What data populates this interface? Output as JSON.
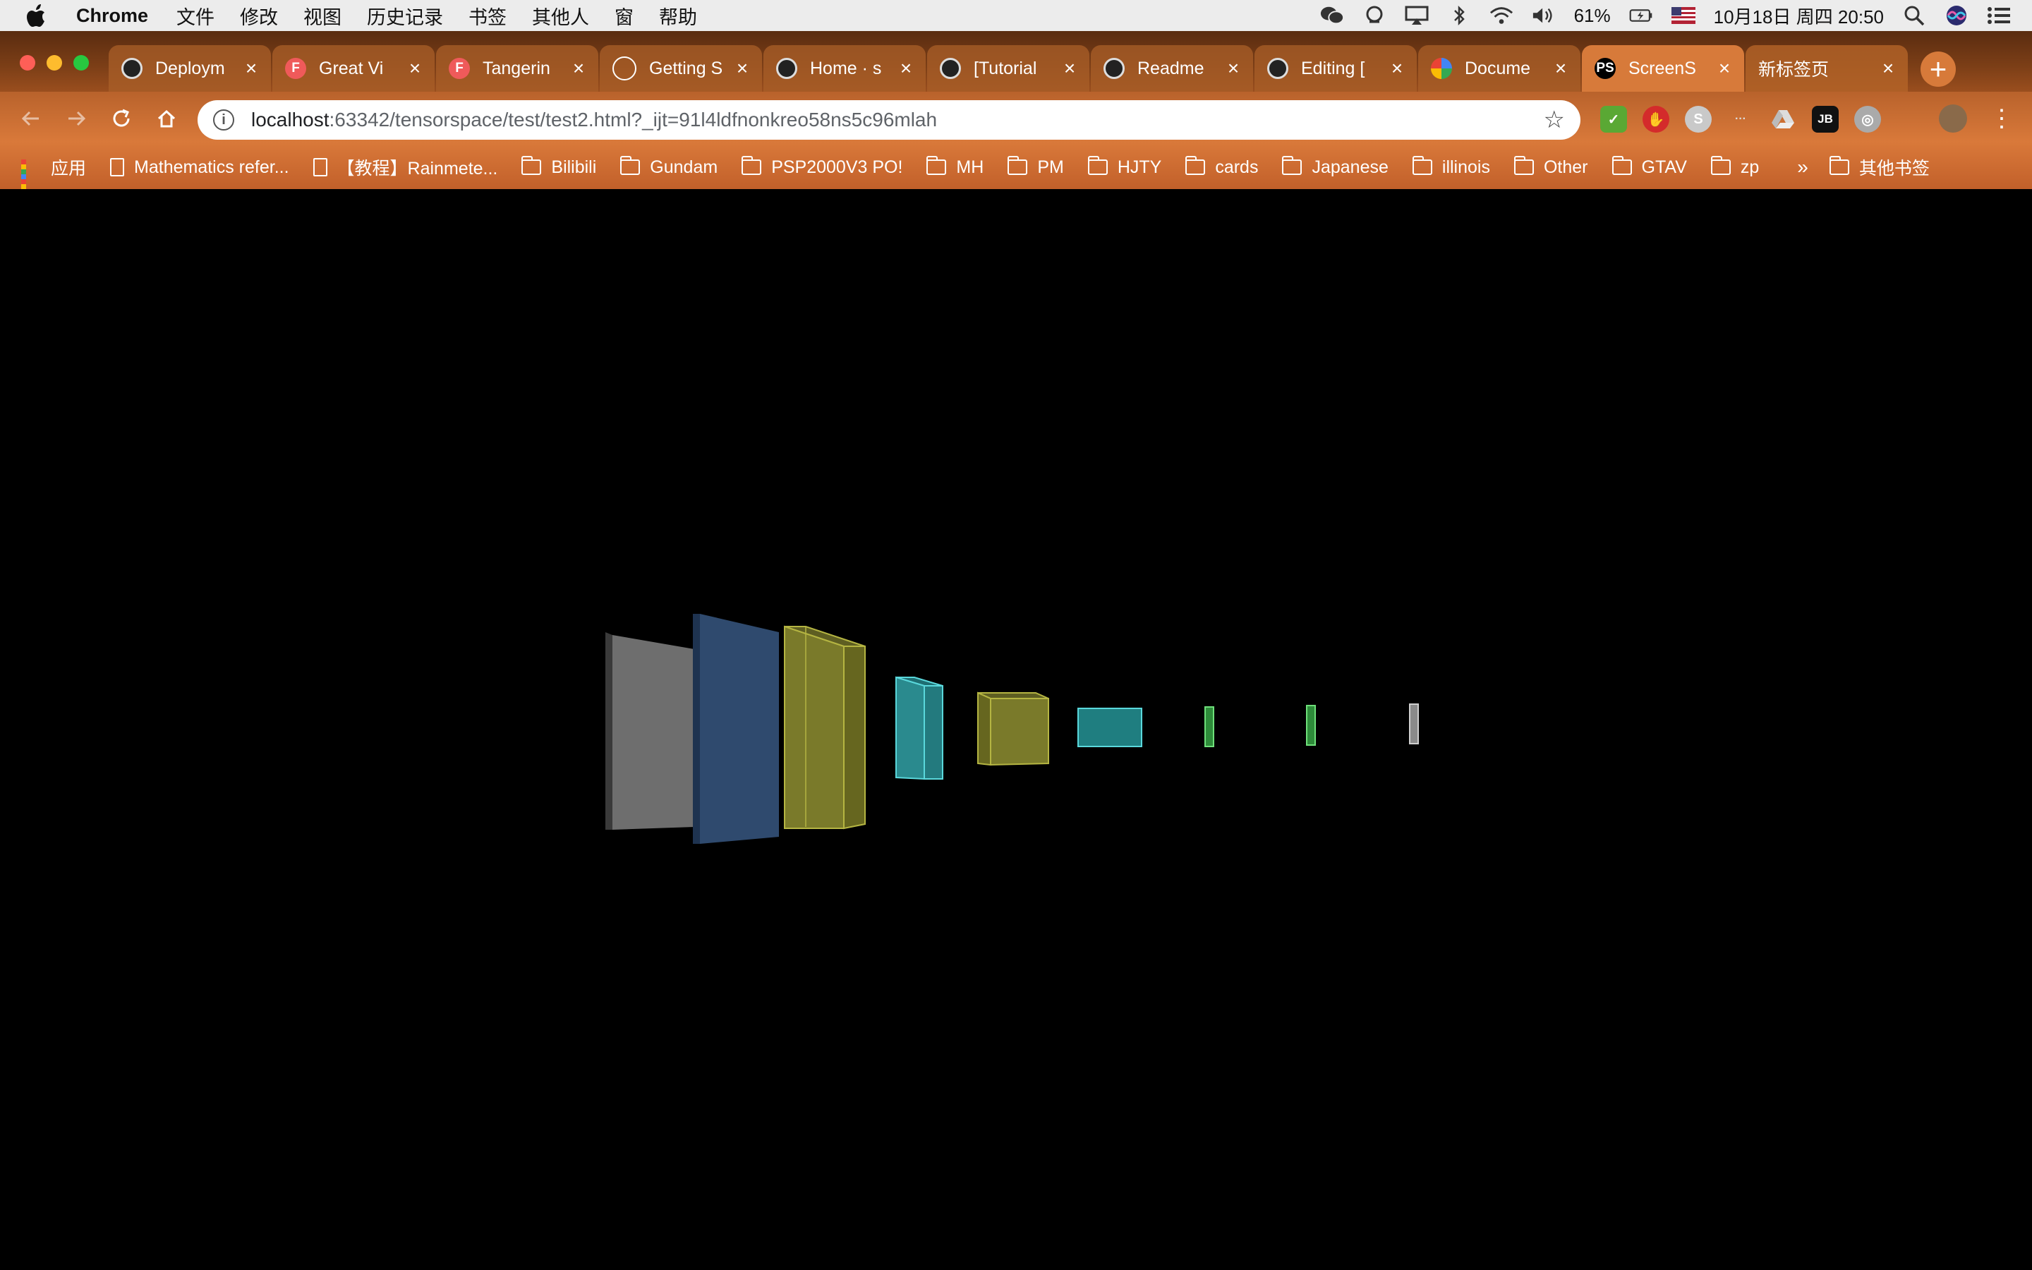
{
  "menubar": {
    "app_name": "Chrome",
    "items": [
      "文件",
      "修改",
      "视图",
      "历史记录",
      "书签",
      "其他人",
      "窗",
      "帮助"
    ],
    "battery": "61%",
    "datetime": "10月18日 周四 20:50"
  },
  "tabs": [
    {
      "title": "Deploym",
      "favicon": "github-icon"
    },
    {
      "title": "Great Vi",
      "favicon": "figma-f-icon"
    },
    {
      "title": "Tangerin",
      "favicon": "figma-f-icon"
    },
    {
      "title": "Getting S",
      "favicon": "document-icon"
    },
    {
      "title": "Home · s",
      "favicon": "github-icon"
    },
    {
      "title": "[Tutorial",
      "favicon": "github-icon"
    },
    {
      "title": "Readme",
      "favicon": "github-icon"
    },
    {
      "title": "Editing [",
      "favicon": "github-icon"
    },
    {
      "title": "Docume",
      "favicon": "google-icon"
    },
    {
      "title": "ScreenS",
      "favicon": "phpstorm-icon",
      "active": true
    },
    {
      "title": "新标签页",
      "favicon": "none"
    }
  ],
  "address": {
    "host": "localhost",
    "path": ":63342/tensorspace/test/test2.html?_ijt=91l4ldfnonkreo58ns5c96mlah"
  },
  "bookmarks": {
    "apps_label": "应用",
    "items": [
      {
        "label": "Mathematics refer...",
        "icon": "page"
      },
      {
        "label": "【教程】Rainmete...",
        "icon": "page"
      },
      {
        "label": "Bilibili",
        "icon": "folder"
      },
      {
        "label": "Gundam",
        "icon": "folder"
      },
      {
        "label": "PSP2000V3 PO!",
        "icon": "folder"
      },
      {
        "label": "MH",
        "icon": "folder"
      },
      {
        "label": "PM",
        "icon": "folder"
      },
      {
        "label": "HJTY",
        "icon": "folder"
      },
      {
        "label": "cards",
        "icon": "folder"
      },
      {
        "label": "Japanese",
        "icon": "folder"
      },
      {
        "label": "illinois",
        "icon": "folder"
      },
      {
        "label": "Other",
        "icon": "folder"
      },
      {
        "label": "GTAV",
        "icon": "folder"
      },
      {
        "label": "zp",
        "icon": "folder"
      }
    ],
    "more": "»",
    "other_bookmarks": "其他书签"
  },
  "scene": {
    "background": "#000000",
    "layers": [
      {
        "name": "input-layer",
        "color": "#6e6e6e"
      },
      {
        "name": "conv-layer-1",
        "color": "#2f4a6e"
      },
      {
        "name": "conv-layer-2",
        "color": "#7a7a2a"
      },
      {
        "name": "pool-layer-1",
        "color": "#2a8a8e"
      },
      {
        "name": "conv-layer-3",
        "color": "#7a7a2a"
      },
      {
        "name": "pool-layer-2",
        "color": "#1f7e80"
      },
      {
        "name": "dense-layer-1",
        "color": "#2e8b3a"
      },
      {
        "name": "dense-layer-2",
        "color": "#2e8b3a"
      },
      {
        "name": "output-layer",
        "color": "#8a8a8a"
      }
    ]
  }
}
